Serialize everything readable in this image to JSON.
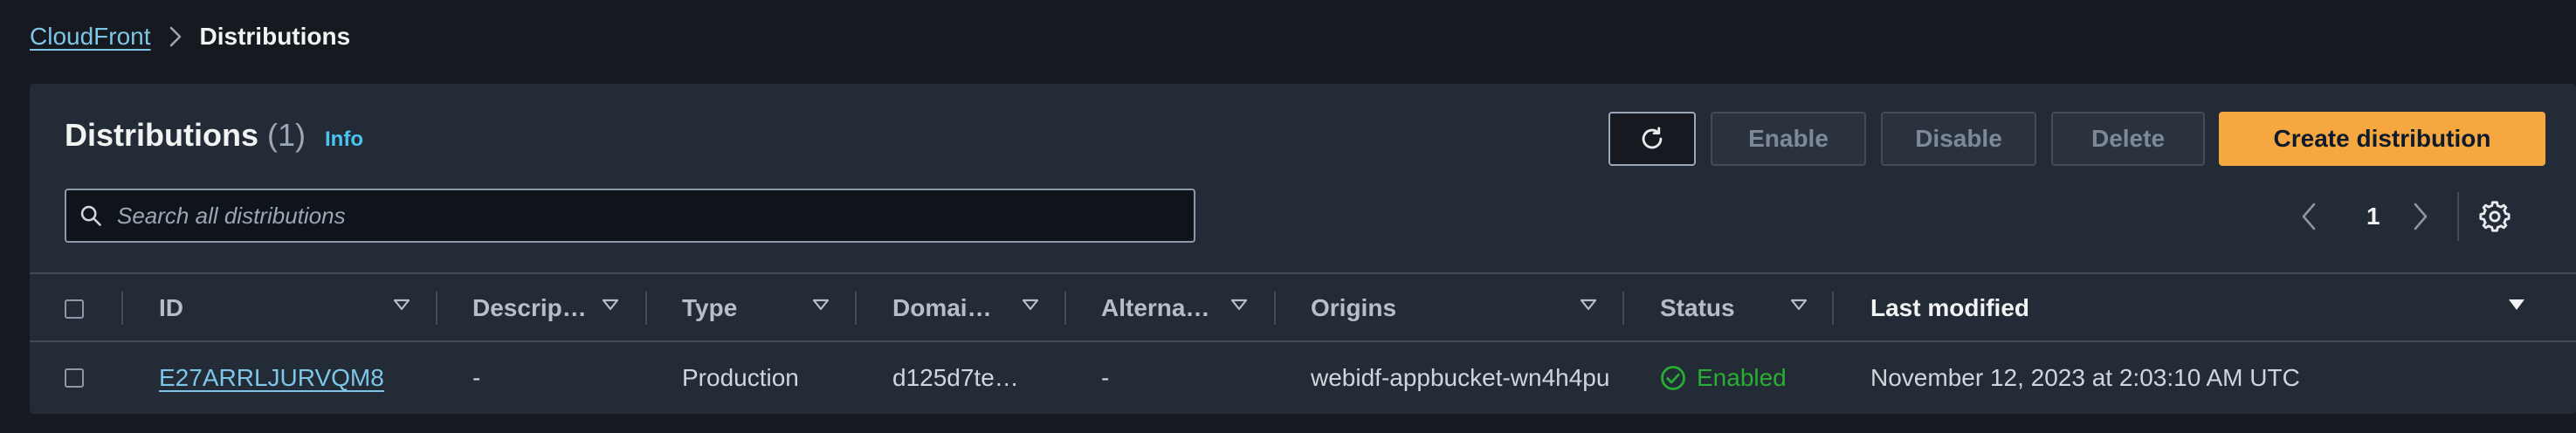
{
  "breadcrumb": {
    "parent": "CloudFront",
    "current": "Distributions"
  },
  "header": {
    "title": "Distributions",
    "count": "(1)",
    "info": "Info"
  },
  "actions": {
    "enable": "Enable",
    "disable": "Disable",
    "delete": "Delete",
    "create": "Create distribution"
  },
  "search": {
    "placeholder": "Search all distributions",
    "value": ""
  },
  "pagination": {
    "current_page": "1"
  },
  "table": {
    "columns": [
      "ID",
      "Descrip…",
      "Type",
      "Domai…",
      "Alterna…",
      "Origins",
      "Status",
      "Last modified"
    ],
    "rows": [
      {
        "id": "E27ARRLJURVQM8",
        "description": "-",
        "type": "Production",
        "domain": "d125d7te…",
        "alternate": "-",
        "origins": "webidf-appbucket-wn4h4pu",
        "status": "Enabled",
        "last_modified": "November 12, 2023 at 2:03:10 AM UTC"
      }
    ]
  },
  "colors": {
    "accent": "#f7a740",
    "link": "#7dc6e8",
    "status_ok": "#29ad32",
    "panel": "#232b37",
    "background": "#16191f"
  },
  "icons": [
    "chevron-right-icon",
    "refresh-icon",
    "search-icon",
    "chevron-left-icon",
    "gear-icon",
    "caret-down-icon",
    "check-circle-icon"
  ]
}
